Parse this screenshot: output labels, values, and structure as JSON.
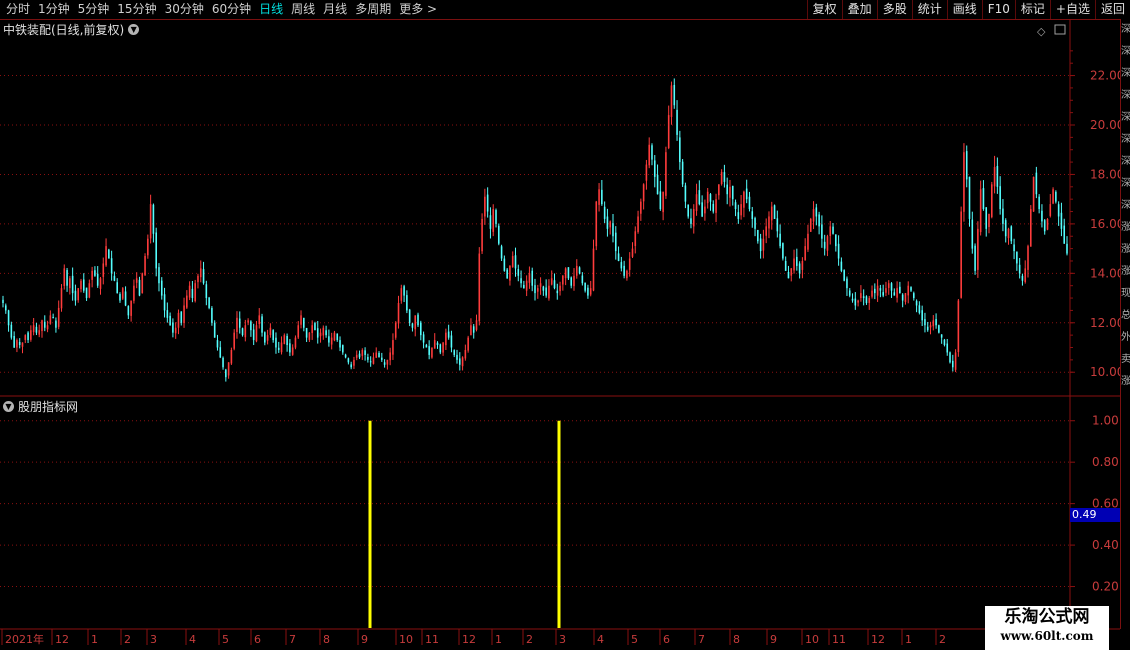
{
  "toolbar": {
    "periods": [
      "分时",
      "1分钟",
      "5分钟",
      "15分钟",
      "30分钟",
      "60分钟",
      "日线",
      "周线",
      "月线",
      "多周期",
      "更多 >"
    ],
    "active_period": "日线",
    "buttons": [
      "复权",
      "叠加",
      "多股",
      "统计",
      "画线",
      "F10",
      "标记",
      "+自选",
      "返回"
    ]
  },
  "main_chart": {
    "title": "中铁装配(日线,前复权)",
    "price_axis": [
      "22.00",
      "20.00",
      "18.00",
      "16.00",
      "14.00",
      "12.00",
      "10.00"
    ],
    "colors": {
      "up": "#ff3c3c",
      "down": "#54ffff",
      "grid": "#8a1010"
    }
  },
  "indicator": {
    "title": "股朋指标网",
    "axis": [
      "1.00",
      "0.80",
      "0.60",
      "0.40",
      "0.20"
    ],
    "current_value": "0.49",
    "signal_color": "#ffff00"
  },
  "time_axis": {
    "labels": [
      "2021年",
      "12",
      "1",
      "2",
      "3",
      "4",
      "5",
      "6",
      "7",
      "8",
      "9",
      "10",
      "11",
      "12",
      "1",
      "2",
      "3",
      "4",
      "5",
      "6",
      "7",
      "8",
      "9",
      "10",
      "11",
      "12",
      "1",
      "2"
    ]
  },
  "watermark": {
    "title": "乐淘公式网",
    "url": "www.60lt.com"
  },
  "right_strip": [
    "深",
    "深",
    "深",
    "深",
    "深",
    "深",
    "深",
    "深",
    "深",
    "涨",
    "涨",
    "涨",
    "现",
    "总",
    "外",
    "卖",
    "涨"
  ],
  "chart_data": {
    "type": "candlestick",
    "price_range": [
      9.2,
      23.6
    ],
    "indicator_range": [
      0,
      1.1
    ],
    "signal_bars": [
      {
        "position_label": "9",
        "value": 1.0
      },
      {
        "position_label": "3",
        "value": 1.0
      }
    ],
    "closes": [
      12.8,
      12.5,
      11.9,
      11.4,
      11.0,
      11.3,
      11.1,
      11.2,
      11.5,
      11.3,
      11.7,
      11.9,
      11.6,
      11.7,
      12.1,
      11.8,
      11.9,
      12.3,
      12.2,
      11.8,
      12.6,
      13.4,
      14.2,
      13.5,
      13.8,
      13.2,
      12.9,
      13.4,
      13.7,
      13.3,
      13.0,
      13.6,
      14.1,
      13.9,
      13.5,
      13.8,
      14.4,
      15.1,
      14.6,
      14.0,
      13.7,
      13.2,
      12.9,
      13.4,
      12.7,
      12.3,
      12.9,
      13.5,
      13.8,
      13.1,
      14.0,
      14.7,
      15.4,
      16.8,
      15.6,
      14.2,
      13.6,
      13.1,
      12.5,
      12.2,
      11.9,
      11.6,
      11.8,
      12.4,
      12.0,
      12.7,
      13.1,
      13.5,
      13.0,
      13.6,
      13.9,
      14.2,
      13.6,
      13.0,
      12.6,
      12.0,
      11.4,
      11.0,
      10.6,
      10.2,
      9.8,
      10.4,
      10.9,
      11.6,
      12.2,
      11.8,
      11.5,
      11.9,
      12.1,
      11.7,
      11.3,
      11.9,
      12.3,
      11.6,
      11.2,
      11.5,
      11.8,
      11.3,
      11.0,
      10.9,
      11.2,
      11.5,
      11.1,
      10.8,
      11.0,
      11.4,
      11.9,
      12.3,
      11.8,
      11.4,
      11.6,
      11.9,
      11.7,
      11.4,
      11.6,
      11.8,
      11.5,
      11.2,
      11.4,
      11.6,
      11.3,
      11.0,
      10.8,
      10.6,
      10.4,
      10.2,
      10.5,
      10.7,
      10.6,
      10.9,
      10.7,
      10.5,
      10.4,
      10.6,
      10.8,
      10.6,
      10.5,
      10.3,
      10.5,
      10.8,
      11.3,
      12.0,
      12.8,
      13.4,
      13.1,
      12.5,
      12.0,
      11.8,
      12.3,
      11.9,
      11.5,
      11.2,
      11.0,
      10.7,
      11.0,
      11.3,
      11.1,
      10.8,
      11.2,
      11.6,
      11.4,
      11.0,
      10.7,
      10.5,
      10.3,
      10.6,
      10.9,
      11.4,
      11.9,
      11.6,
      12.1,
      14.8,
      16.2,
      17.1,
      16.5,
      15.8,
      16.6,
      16.0,
      15.2,
      14.6,
      14.1,
      13.8,
      14.3,
      14.7,
      14.2,
      13.9,
      13.6,
      13.4,
      13.7,
      14.0,
      13.5,
      13.2,
      13.4,
      13.6,
      13.3,
      13.1,
      13.5,
      13.8,
      13.4,
      13.2,
      13.5,
      13.9,
      14.2,
      13.8,
      13.5,
      13.9,
      14.3,
      14.0,
      13.6,
      13.3,
      13.1,
      13.4,
      15.0,
      16.9,
      17.4,
      16.8,
      16.2,
      15.8,
      16.1,
      15.5,
      14.9,
      14.5,
      14.2,
      13.9,
      14.1,
      14.6,
      15.0,
      15.7,
      16.3,
      16.9,
      17.6,
      18.4,
      19.2,
      18.6,
      17.9,
      17.2,
      16.6,
      17.3,
      18.9,
      20.4,
      21.6,
      20.8,
      19.6,
      18.5,
      17.6,
      16.9,
      16.3,
      16.0,
      16.6,
      17.2,
      16.8,
      16.3,
      16.7,
      17.3,
      16.9,
      16.5,
      17.0,
      17.6,
      18.1,
      17.7,
      17.2,
      17.5,
      17.0,
      16.6,
      16.2,
      16.8,
      17.3,
      17.0,
      16.6,
      16.2,
      15.8,
      15.3,
      14.9,
      15.4,
      15.9,
      16.3,
      16.7,
      16.2,
      15.7,
      15.1,
      14.6,
      14.1,
      13.8,
      14.2,
      14.6,
      14.3,
      14.0,
      14.5,
      15.1,
      15.6,
      16.2,
      16.6,
      16.3,
      15.9,
      15.4,
      15.0,
      15.5,
      15.9,
      15.6,
      15.1,
      14.6,
      14.1,
      13.7,
      13.4,
      13.1,
      12.9,
      12.7,
      12.9,
      13.2,
      13.0,
      12.8,
      13.0,
      13.3,
      13.2,
      13.5,
      13.3,
      13.1,
      13.4,
      13.6,
      13.3,
      13.1,
      13.4,
      13.2,
      12.9,
      13.2,
      13.5,
      13.3,
      13.0,
      12.7,
      12.4,
      12.1,
      11.9,
      11.7,
      11.9,
      12.1,
      11.9,
      11.6,
      11.4,
      11.1,
      10.8,
      10.4,
      10.2,
      10.8,
      12.9,
      16.5,
      18.9,
      17.8,
      16.2,
      15.0,
      14.1,
      15.8,
      17.4,
      16.6,
      15.8,
      16.4,
      17.6,
      18.3,
      17.5,
      16.6,
      16.0,
      15.5,
      15.8,
      15.3,
      14.9,
      14.4,
      14.0,
      13.7,
      14.2,
      15.1,
      16.6,
      17.9,
      17.2,
      16.6,
      16.1,
      15.7,
      16.2,
      16.8,
      17.4,
      16.9,
      16.3,
      15.8,
      15.2,
      14.8
    ]
  }
}
